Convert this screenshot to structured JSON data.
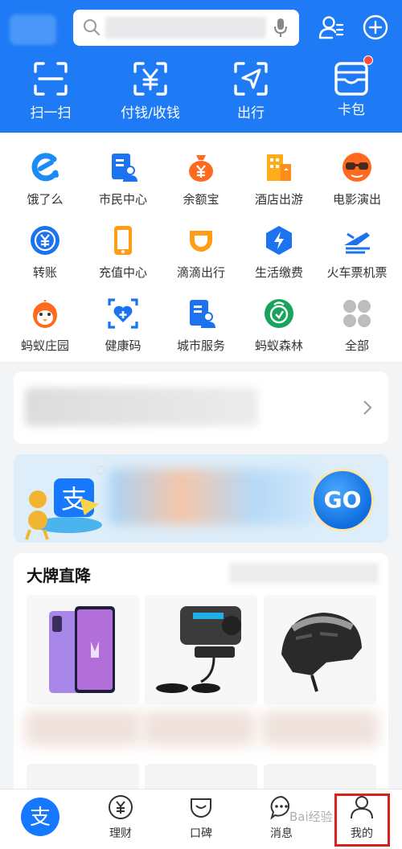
{
  "header": {
    "search": {
      "placeholder": ""
    },
    "quick_actions": [
      {
        "label": "扫一扫",
        "icon": "scan-icon"
      },
      {
        "label": "付钱/收钱",
        "icon": "yuan-pay-icon"
      },
      {
        "label": "出行",
        "icon": "travel-arrow-icon"
      },
      {
        "label": "卡包",
        "icon": "card-wallet-icon"
      }
    ]
  },
  "apps": [
    {
      "label": "饿了么",
      "icon": "eleme-icon"
    },
    {
      "label": "市民中心",
      "icon": "citizen-center-icon"
    },
    {
      "label": "余额宝",
      "icon": "yuebao-icon"
    },
    {
      "label": "酒店出游",
      "icon": "hotel-icon"
    },
    {
      "label": "电影演出",
      "icon": "movie-icon"
    },
    {
      "label": "转账",
      "icon": "transfer-icon"
    },
    {
      "label": "充值中心",
      "icon": "recharge-icon"
    },
    {
      "label": "滴滴出行",
      "icon": "didi-icon"
    },
    {
      "label": "生活缴费",
      "icon": "utility-icon"
    },
    {
      "label": "火车票机票",
      "icon": "train-plane-icon"
    },
    {
      "label": "蚂蚁庄园",
      "icon": "ant-farm-icon"
    },
    {
      "label": "健康码",
      "icon": "health-code-icon"
    },
    {
      "label": "城市服务",
      "icon": "city-service-icon"
    },
    {
      "label": "蚂蚁森林",
      "icon": "ant-forest-icon"
    },
    {
      "label": "全部",
      "icon": "all-apps-icon"
    }
  ],
  "promo": {
    "go_label": "GO",
    "logo_char": "支"
  },
  "brand_section": {
    "title": "大牌直降"
  },
  "tabbar": {
    "home_char": "支",
    "tabs": [
      {
        "label": "理财",
        "icon": "wealth-icon"
      },
      {
        "label": "口碑",
        "icon": "koubei-icon"
      },
      {
        "label": "消息",
        "icon": "message-icon"
      },
      {
        "label": "我的",
        "icon": "profile-icon"
      }
    ]
  },
  "watermark": "Bai经验",
  "colors": {
    "brand_blue": "#1e7bf5",
    "highlight_red": "#d9201a",
    "badge_red": "#ff4a3d"
  }
}
